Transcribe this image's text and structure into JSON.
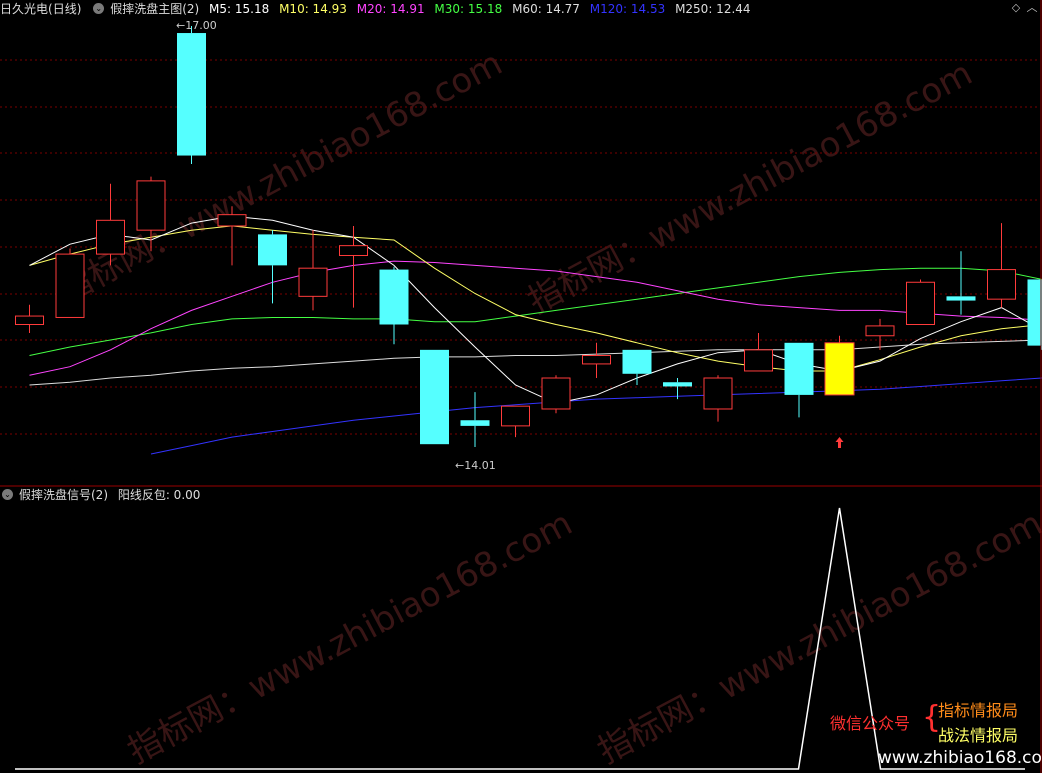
{
  "main_header": {
    "stock": "日久光电",
    "period": "(日线)",
    "indicator": "假摔洗盘主图(2)",
    "ma": [
      {
        "label": "M5: 15.18",
        "color": "#ffffff"
      },
      {
        "label": "M10: 14.93",
        "color": "#ffff66"
      },
      {
        "label": "M20: 14.91",
        "color": "#ff44ff"
      },
      {
        "label": "M30: 15.18",
        "color": "#44ff44"
      },
      {
        "label": "M60: 14.77",
        "color": "#dddddd"
      },
      {
        "label": "M120: 14.53",
        "color": "#3333ff"
      },
      {
        "label": "M250: 12.44",
        "color": "#dddddd"
      }
    ]
  },
  "sub_header": {
    "indicator": "假摔洗盘信号(2)",
    "signal": "阳线反包: 0.00"
  },
  "price_labels": {
    "high": "17.00",
    "low": "14.01"
  },
  "watermark": [
    "指标网：www.zhibiao168.com"
  ],
  "brand": {
    "left": "微信公众号",
    "right1": "指标情报局",
    "right2": "战法情报局",
    "site": "www.zhibiao168.com"
  },
  "colors": {
    "up": "#ff3b3b",
    "down": "#55ffff",
    "signal": "#ffff00",
    "ma5": "#ffffff",
    "ma10": "#ffff66",
    "ma20": "#ff44ff",
    "ma30": "#44ff44",
    "ma60": "#dddddd",
    "ma120": "#3333ff",
    "grid": "#7a0000"
  },
  "candles": [
    {
      "o": 14.88,
      "h": 15.02,
      "l": 14.82,
      "c": 14.94
    },
    {
      "o": 14.93,
      "h": 15.42,
      "l": 14.93,
      "c": 15.38
    },
    {
      "o": 15.38,
      "h": 15.88,
      "l": 15.3,
      "c": 15.62
    },
    {
      "o": 15.55,
      "h": 15.93,
      "l": 15.4,
      "c": 15.9
    },
    {
      "o": 16.95,
      "h": 17.0,
      "l": 16.02,
      "c": 16.08
    },
    {
      "o": 15.58,
      "h": 15.72,
      "l": 15.3,
      "c": 15.66
    },
    {
      "o": 15.52,
      "h": 15.55,
      "l": 15.03,
      "c": 15.3
    },
    {
      "o": 15.08,
      "h": 15.55,
      "l": 14.98,
      "c": 15.28
    },
    {
      "o": 15.37,
      "h": 15.58,
      "l": 15.0,
      "c": 15.44
    },
    {
      "o": 15.27,
      "h": 15.29,
      "l": 14.74,
      "c": 14.88
    },
    {
      "o": 14.7,
      "h": 14.7,
      "l": 14.03,
      "c": 14.03
    },
    {
      "o": 14.2,
      "h": 14.4,
      "l": 14.01,
      "c": 14.16
    },
    {
      "o": 14.16,
      "h": 14.3,
      "l": 14.08,
      "c": 14.3
    },
    {
      "o": 14.28,
      "h": 14.52,
      "l": 14.25,
      "c": 14.5
    },
    {
      "o": 14.6,
      "h": 14.75,
      "l": 14.5,
      "c": 14.66
    },
    {
      "o": 14.7,
      "h": 14.7,
      "l": 14.45,
      "c": 14.53
    },
    {
      "o": 14.47,
      "h": 14.5,
      "l": 14.35,
      "c": 14.44
    },
    {
      "o": 14.28,
      "h": 14.52,
      "l": 14.19,
      "c": 14.5
    },
    {
      "o": 14.55,
      "h": 14.82,
      "l": 14.55,
      "c": 14.7
    },
    {
      "o": 14.75,
      "h": 14.75,
      "l": 14.22,
      "c": 14.38
    },
    {
      "o": 14.38,
      "h": 14.8,
      "l": 14.38,
      "c": 14.75
    },
    {
      "o": 14.8,
      "h": 14.92,
      "l": 14.7,
      "c": 14.87
    },
    {
      "o": 14.88,
      "h": 15.2,
      "l": 14.88,
      "c": 15.18
    },
    {
      "o": 15.08,
      "h": 15.4,
      "l": 14.95,
      "c": 15.05
    },
    {
      "o": 15.06,
      "h": 15.6,
      "l": 15.0,
      "c": 15.27
    },
    {
      "o": 15.2,
      "h": 15.2,
      "l": 14.7,
      "c": 14.73
    }
  ],
  "signal_candle_index": 20,
  "arrow_candle_index": 20,
  "ma_lines": {
    "ma5": [
      15.3,
      15.45,
      15.52,
      15.48,
      15.6,
      15.65,
      15.62,
      15.55,
      15.5,
      15.3,
      15.0,
      14.72,
      14.45,
      14.32,
      14.38,
      14.5,
      14.6,
      14.68,
      14.7,
      14.6,
      14.55,
      14.62,
      14.78,
      14.9,
      15.0,
      14.84
    ],
    "ma10": [
      15.3,
      15.38,
      15.45,
      15.5,
      15.55,
      15.58,
      15.55,
      15.52,
      15.5,
      15.48,
      15.28,
      15.1,
      14.95,
      14.88,
      14.82,
      14.75,
      14.68,
      14.62,
      14.58,
      14.55,
      14.55,
      14.63,
      14.72,
      14.8,
      14.85,
      14.88
    ],
    "ma20": [
      14.52,
      14.58,
      14.7,
      14.85,
      14.98,
      15.08,
      15.18,
      15.25,
      15.3,
      15.33,
      15.32,
      15.3,
      15.28,
      15.26,
      15.22,
      15.18,
      15.12,
      15.06,
      15.02,
      15.0,
      14.98,
      14.98,
      14.96,
      14.94,
      14.93,
      14.91
    ],
    "ma30": [
      14.66,
      14.72,
      14.77,
      14.82,
      14.88,
      14.92,
      14.93,
      14.93,
      14.92,
      14.92,
      14.9,
      14.9,
      14.94,
      14.98,
      15.02,
      15.06,
      15.1,
      15.14,
      15.18,
      15.22,
      15.25,
      15.27,
      15.28,
      15.28,
      15.26,
      15.2
    ],
    "ma60": [
      14.45,
      14.47,
      14.5,
      14.52,
      14.55,
      14.57,
      14.58,
      14.6,
      14.62,
      14.64,
      14.65,
      14.65,
      14.66,
      14.66,
      14.67,
      14.68,
      14.69,
      14.7,
      14.7,
      14.7,
      14.7,
      14.72,
      14.74,
      14.75,
      14.76,
      14.77
    ],
    "ma120_segment": {
      "from_index": 3,
      "values": [
        13.96,
        14.02,
        14.08,
        14.12,
        14.16,
        14.2,
        14.23,
        14.26,
        14.29,
        14.31,
        14.33,
        14.35,
        14.36,
        14.37,
        14.38,
        14.39,
        14.4,
        14.41,
        14.42,
        14.44,
        14.46,
        14.48,
        14.5,
        14.52,
        14.53
      ]
    }
  },
  "signal_series": {
    "spike_index": 20,
    "baseline_label": "0.00"
  }
}
